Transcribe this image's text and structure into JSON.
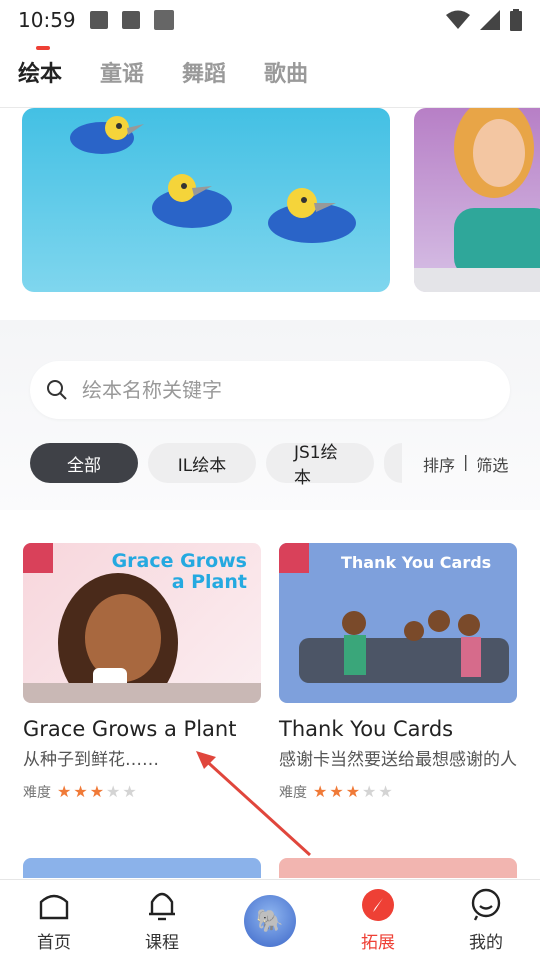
{
  "status_bar": {
    "time": "10:59"
  },
  "tabs": [
    {
      "label": "绘本"
    },
    {
      "label": "童谣"
    },
    {
      "label": "舞蹈"
    },
    {
      "label": "歌曲"
    }
  ],
  "search": {
    "placeholder": "绘本名称关键字"
  },
  "filter_chips": [
    {
      "label": "全部"
    },
    {
      "label": "IL绘本"
    },
    {
      "label": "JS1绘本"
    }
  ],
  "sort_filter": {
    "sort": "排序",
    "separator": "|",
    "filter": "筛选"
  },
  "books": [
    {
      "thumb_title": "Grace Grows a Plant",
      "title": "Grace Grows a Plant",
      "desc": "从种子到鲜花……",
      "difficulty_label": "难度",
      "rating": 3,
      "rating_max": 5
    },
    {
      "thumb_title": "Thank You Cards",
      "title": "Thank You Cards",
      "desc": "感谢卡当然要送给最想感谢的人",
      "difficulty_label": "难度",
      "rating": 3,
      "rating_max": 5
    }
  ],
  "nav": [
    {
      "label": "首页"
    },
    {
      "label": "课程"
    },
    {
      "label": ""
    },
    {
      "label": "拓展"
    },
    {
      "label": "我的"
    }
  ],
  "colors": {
    "accent": "#ee4035",
    "star": "#f07a38",
    "chip_active": "#3f4147"
  }
}
